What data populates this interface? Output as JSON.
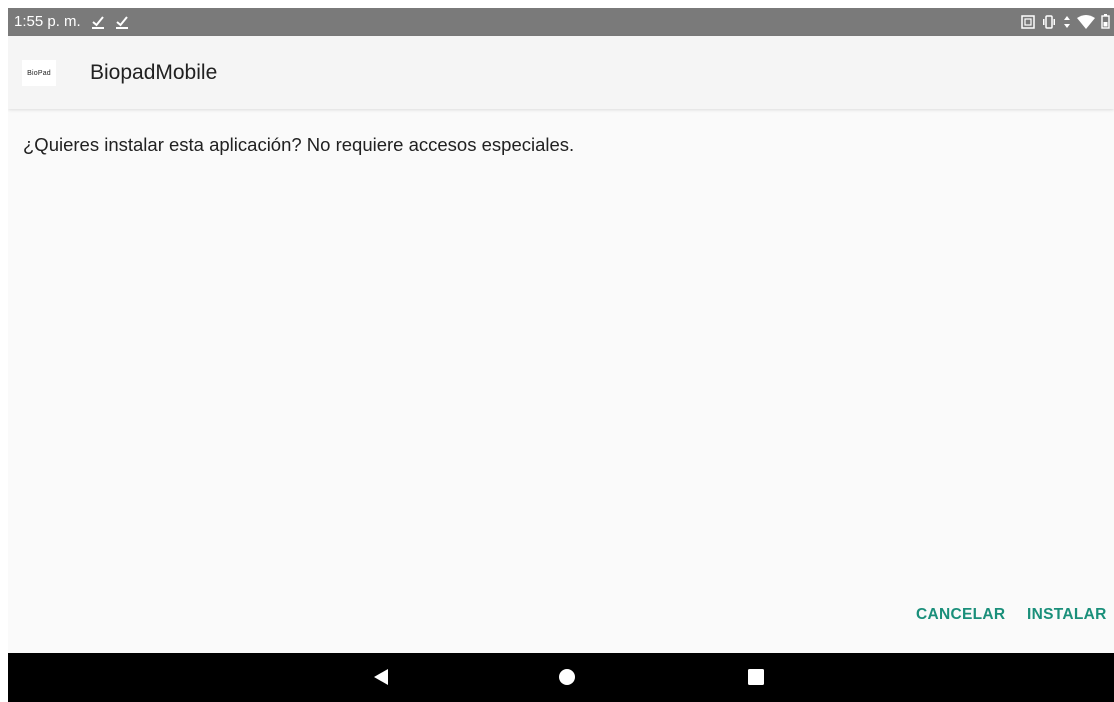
{
  "status_bar": {
    "time": "1:55 p. m.",
    "left_icons": [
      "download-done-icon",
      "download-done-icon"
    ],
    "right_icons": [
      "screenshot-icon",
      "vibrate-icon",
      "data-arrows-icon",
      "wifi-icon",
      "battery-icon"
    ]
  },
  "app": {
    "logo_text": "BioPad",
    "title": "BiopadMobile"
  },
  "dialog": {
    "question": "¿Quieres instalar esta aplicación? No requiere accesos especiales.",
    "cancel_label": "CANCELAR",
    "install_label": "INSTALAR"
  },
  "nav": {
    "buttons": [
      "back-icon",
      "home-icon",
      "recents-icon"
    ]
  },
  "colors": {
    "accent": "#1a8f7a",
    "status_bar": "#7a7a7a",
    "nav_bar": "#000000"
  }
}
